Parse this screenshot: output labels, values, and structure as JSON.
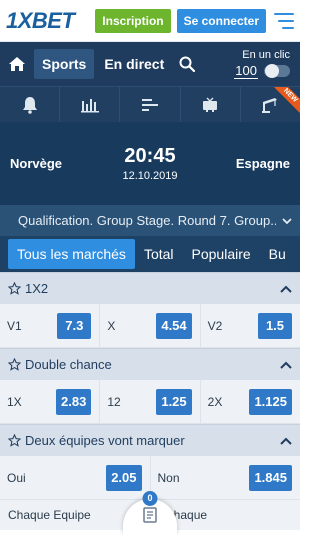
{
  "header": {
    "logo": "1XBET",
    "signup_label": "Inscription",
    "login_label": "Se connecter"
  },
  "nav": {
    "sports_label": "Sports",
    "live_label": "En direct",
    "oneclick_label": "En un clic",
    "oneclick_amount": "100",
    "oneclick_enabled": false
  },
  "iconstrip": {
    "icons": [
      "bell-icon",
      "stats-icon",
      "lineup-icon",
      "tv-icon",
      "crane-icon"
    ],
    "new_badge": "NEW",
    "new_badge_color": "#e85a1c"
  },
  "match": {
    "home_team": "Norvège",
    "away_team": "Espagne",
    "time": "20:45",
    "date": "12.10.2019"
  },
  "competition": {
    "label": "Qualification. Group Stage. Round 7. Group..."
  },
  "tabs": [
    {
      "label": "Tous les marchés",
      "active": true
    },
    {
      "label": "Total",
      "active": false
    },
    {
      "label": "Populaire",
      "active": false
    },
    {
      "label": "Bu",
      "active": false
    }
  ],
  "markets": [
    {
      "title": "1X2",
      "outcomes": [
        {
          "label": "V1",
          "odd": "7.3"
        },
        {
          "label": "X",
          "odd": "4.54"
        },
        {
          "label": "V2",
          "odd": "1.5"
        }
      ]
    },
    {
      "title": "Double chance",
      "outcomes": [
        {
          "label": "1X",
          "odd": "2.83"
        },
        {
          "label": "12",
          "odd": "1.25"
        },
        {
          "label": "2X",
          "odd": "1.125"
        }
      ]
    },
    {
      "title": "Deux équipes vont marquer",
      "outcomes": [
        {
          "label": "Oui",
          "odd": "2.05"
        },
        {
          "label": "Non",
          "odd": "1.845"
        }
      ]
    }
  ],
  "partial": {
    "left_label": "Chaque Equipe",
    "right_label": "Chaque"
  },
  "coupon": {
    "count": "0"
  },
  "colors": {
    "brand": "#1a5f9e",
    "signup": "#6cb52d",
    "login": "#2f8ee0",
    "nav_bg": "#1f3c5e",
    "odd_bg": "#2f79c8"
  }
}
